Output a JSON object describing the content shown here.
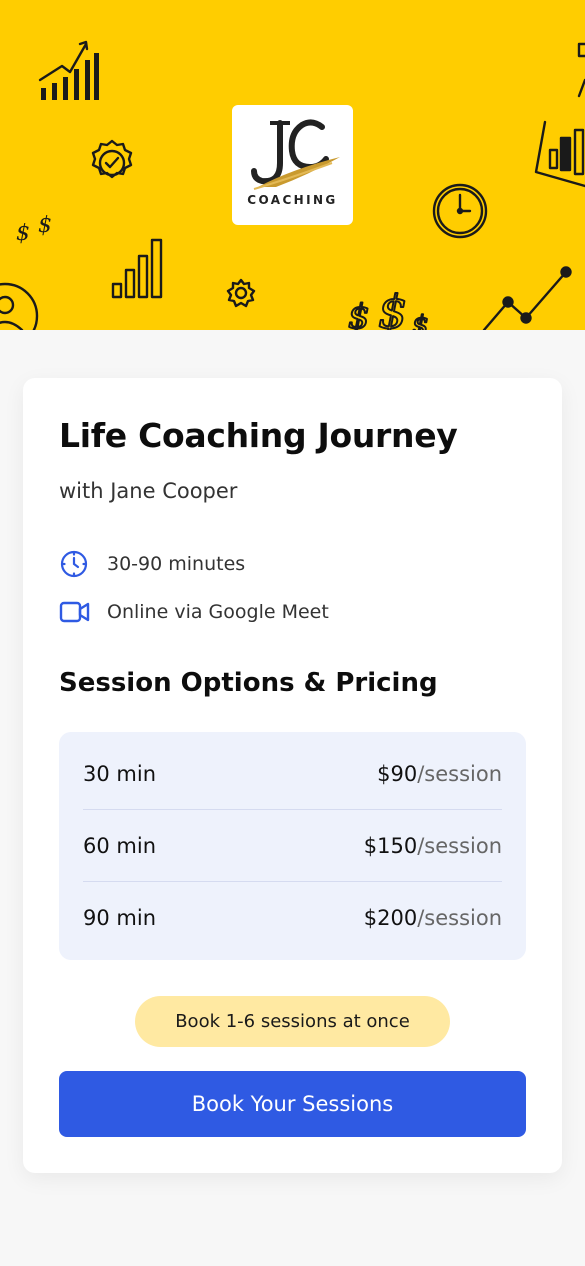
{
  "hero": {
    "background_color": "#ffcd00",
    "logo": {
      "monogram": "JC",
      "word": "COACHING"
    },
    "decorations": [
      "bar-chart-icon",
      "verified-badge-icon",
      "dollar-icon",
      "clock-icon",
      "gear-icon",
      "line-chart-icon",
      "person-icon"
    ]
  },
  "card": {
    "title": "Life Coaching Journey",
    "subtitle": "with Jane Cooper",
    "details": {
      "duration": {
        "icon": "clock-icon",
        "text": "30-90 minutes"
      },
      "location": {
        "icon": "video-camera-icon",
        "text": "Online via Google Meet"
      }
    },
    "pricing_heading": "Session Options & Pricing",
    "pricing": [
      {
        "duration": "30 min",
        "price": "$90",
        "unit": "/session"
      },
      {
        "duration": "60 min",
        "price": "$150",
        "unit": "/session"
      },
      {
        "duration": "90 min",
        "price": "$200",
        "unit": "/session"
      }
    ],
    "badge": "Book 1-6 sessions at once",
    "cta": "Book Your Sessions"
  },
  "colors": {
    "accent": "#2f5ae3",
    "badge_bg": "#ffe9a2",
    "pricing_bg": "#eef2fc"
  }
}
